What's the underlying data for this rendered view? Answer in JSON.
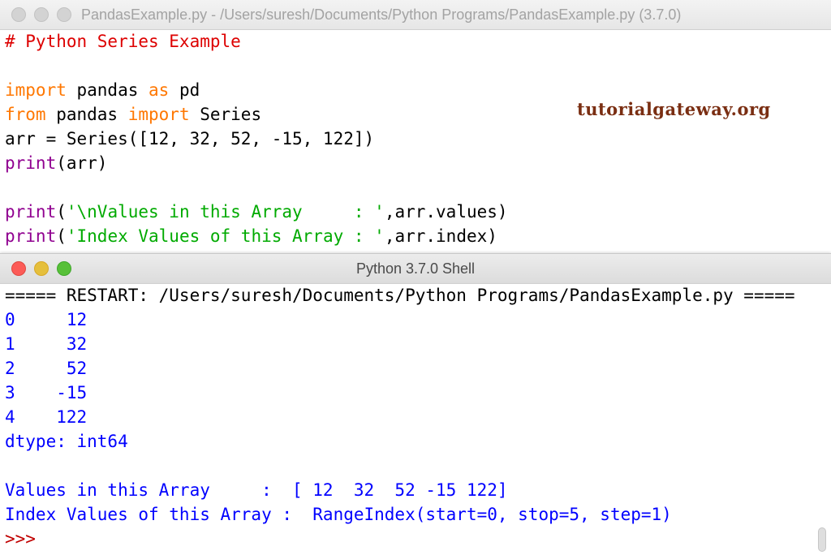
{
  "editor": {
    "title": "PandasExample.py - /Users/suresh/Documents/Python Programs/PandasExample.py (3.7.0)",
    "watermark": "tutorialgateway.org",
    "lines": [
      [
        [
          "comment",
          "# Python Series Example"
        ]
      ],
      [],
      [
        [
          "keyword",
          "import"
        ],
        [
          "default",
          " pandas "
        ],
        [
          "keyword",
          "as"
        ],
        [
          "default",
          " pd"
        ]
      ],
      [
        [
          "keyword",
          "from"
        ],
        [
          "default",
          " pandas "
        ],
        [
          "keyword",
          "import"
        ],
        [
          "default",
          " Series"
        ]
      ],
      [
        [
          "default",
          "arr = Series([12, 32, 52, -15, 122])"
        ]
      ],
      [
        [
          "builtin",
          "print"
        ],
        [
          "default",
          "(arr)"
        ]
      ],
      [],
      [
        [
          "builtin",
          "print"
        ],
        [
          "default",
          "("
        ],
        [
          "string",
          "'\\nValues in this Array     : '"
        ],
        [
          "default",
          ",arr.values)"
        ]
      ],
      [
        [
          "builtin",
          "print"
        ],
        [
          "default",
          "("
        ],
        [
          "string",
          "'Index Values of this Array : '"
        ],
        [
          "default",
          ",arr.index)"
        ]
      ]
    ]
  },
  "shell": {
    "title": "Python 3.7.0 Shell",
    "lines": [
      [
        [
          "default",
          "===== RESTART: /Users/suresh/Documents/Python Programs/PandasExample.py ====="
        ]
      ],
      [
        [
          "output",
          "0     12"
        ]
      ],
      [
        [
          "output",
          "1     32"
        ]
      ],
      [
        [
          "output",
          "2     52"
        ]
      ],
      [
        [
          "output",
          "3    -15"
        ]
      ],
      [
        [
          "output",
          "4    122"
        ]
      ],
      [
        [
          "output",
          "dtype: int64"
        ]
      ],
      [],
      [
        [
          "output",
          "Values in this Array     :  [ 12  32  52 -15 122]"
        ]
      ],
      [
        [
          "output",
          "Index Values of this Array :  RangeIndex(start=0, stop=5, step=1)"
        ]
      ],
      [
        [
          "prompt",
          ">>> "
        ]
      ]
    ]
  }
}
